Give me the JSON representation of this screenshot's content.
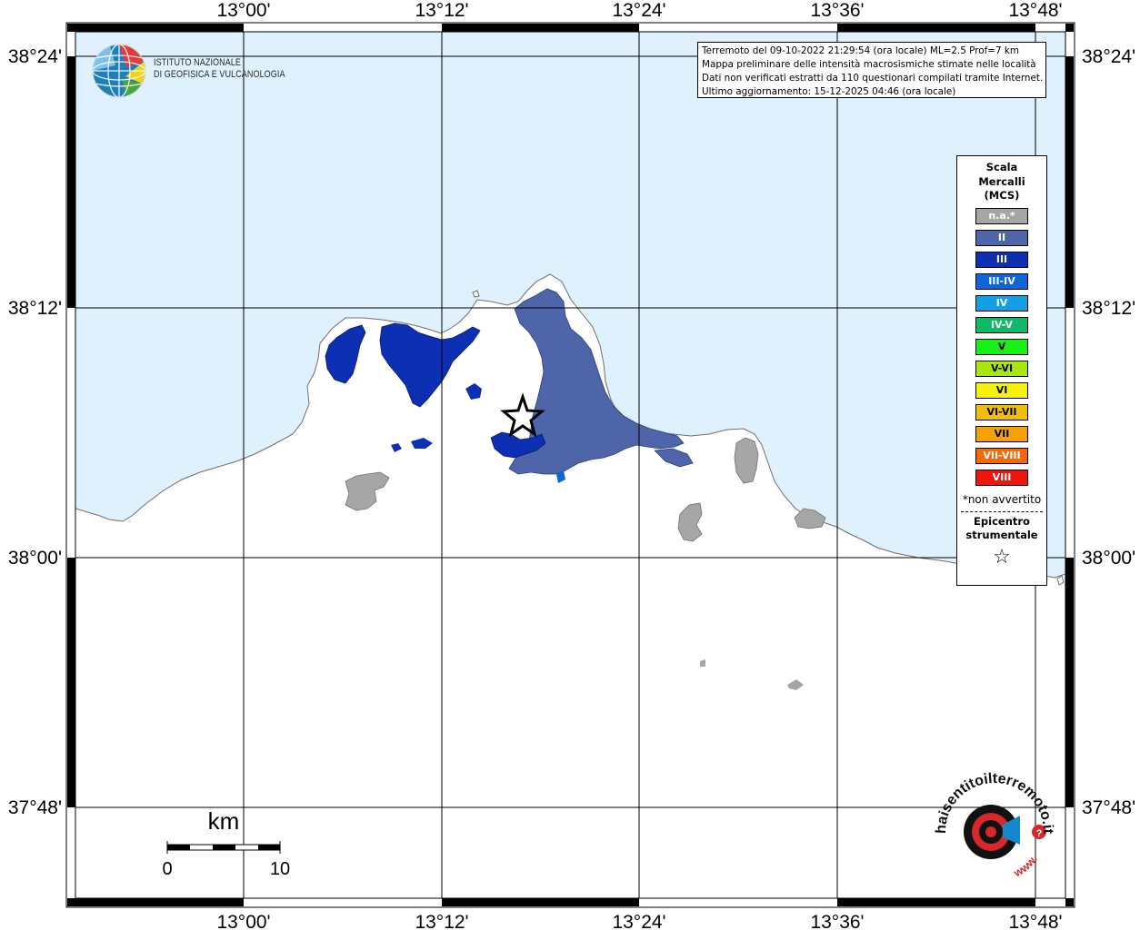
{
  "header": {
    "title_line1": "Terremoto del 09-10-2022 21:29:54 (ora locale) ML=2.5 Prof=7 km",
    "title_line2": "Mappa preliminare delle intensità macrosismiche stimate nelle località",
    "title_line3": "Dati non verificati estratti da 110 questionari compilati tramite Internet.",
    "title_line4": "Ultimo aggiornamento: 15-12-2025 04:46 (ora locale)"
  },
  "institute": {
    "line1": "ISTITUTO NAZIONALE",
    "line2": "DI GEOFISICA E VULCANOLOGIA"
  },
  "axes": {
    "longitudes": [
      "13°00'",
      "13°12'",
      "13°24'",
      "13°36'",
      "13°48'"
    ],
    "latitudes": [
      "38°24'",
      "38°12'",
      "38°00'",
      "37°48'"
    ]
  },
  "legend": {
    "title_line1": "Scala",
    "title_line2": "Mercalli",
    "title_line3": "(MCS)",
    "items": [
      {
        "label": "n.a.*",
        "color": "#a6a6a6"
      },
      {
        "label": "II",
        "color": "#4f65a9"
      },
      {
        "label": "III",
        "color": "#0c2fb3"
      },
      {
        "label": "III-IV",
        "color": "#0e66d6"
      },
      {
        "label": "IV",
        "color": "#149ee6"
      },
      {
        "label": "IV-V",
        "color": "#0fb968"
      },
      {
        "label": "V",
        "color": "#17ef17"
      },
      {
        "label": "V-VI",
        "color": "#a8e60f"
      },
      {
        "label": "VI",
        "color": "#f7f20b"
      },
      {
        "label": "VI-VII",
        "color": "#f3bd0b"
      },
      {
        "label": "VII",
        "color": "#f5a10a"
      },
      {
        "label": "VII-VIII",
        "color": "#f26a0c"
      },
      {
        "label": "VIII",
        "color": "#ee150c"
      }
    ],
    "note": "*non avvertito",
    "epicenter_line1": "Epicentro",
    "epicenter_line2": "strumentale",
    "epicenter_symbol": "☆"
  },
  "scale_bar": {
    "unit": "km",
    "start_label": "0",
    "end_label": "10"
  },
  "watermark": {
    "arc_text": "haisentitoilterremoto.it",
    "arc_text_bottom": "www."
  },
  "colors": {
    "sea": "#dff1fd",
    "land": "#ffffff",
    "intensity_II": "#4f65a9",
    "intensity_III": "#0c2fb3",
    "intensity_III_IV": "#0e66d6",
    "not_felt": "#a6a6a6"
  }
}
